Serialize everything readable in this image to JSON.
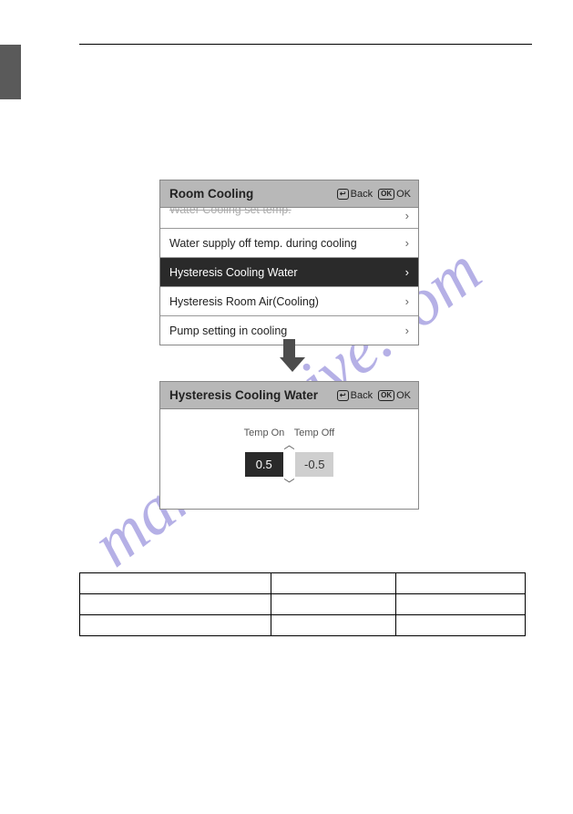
{
  "watermark": "manualshive.com",
  "panel1_title": "Room Cooling",
  "panel2_title": "Hysteresis Cooling Water",
  "back_label": "Back",
  "ok_label": "OK",
  "menu": {
    "item0": "Water Cooling set temp.",
    "item1": "Water supply off temp. during cooling",
    "item2": "Hysteresis Cooling Water",
    "item3": "Hysteresis Room Air(Cooling)",
    "item4": "Pump setting in cooling"
  },
  "adjust": {
    "col1": "Temp On",
    "col2": "Temp Off",
    "val1": "0.5",
    "val2": "-0.5"
  }
}
